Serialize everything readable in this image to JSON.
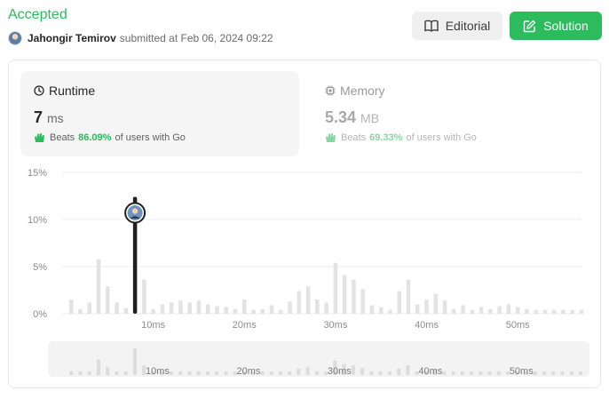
{
  "header": {
    "status": "Accepted",
    "submitter_name": "Jahongir Temirov",
    "submitted_text": "submitted at Feb 06, 2024 09:22",
    "editorial_label": "Editorial",
    "solution_label": "Solution"
  },
  "runtime": {
    "title": "Runtime",
    "value": "7",
    "unit": "ms",
    "beats_label": "Beats",
    "beats_pct": "86.09%",
    "beats_suffix": "of users with Go"
  },
  "memory": {
    "title": "Memory",
    "value": "5.34",
    "unit": "MB",
    "beats_label": "Beats",
    "beats_pct": "69.33%",
    "beats_suffix": "of users with Go"
  },
  "colors": {
    "accent": "#2cbb5d",
    "bar": "#e3e3e3",
    "highlight": "#1f1f1f"
  },
  "chart_data": {
    "type": "bar",
    "title": "",
    "xlabel": "",
    "ylabel": "",
    "y_ticks": [
      "15%",
      "10%",
      "5%",
      "0%"
    ],
    "ylim": [
      0,
      15
    ],
    "xlim": [
      0,
      57
    ],
    "x_ticks": [
      {
        "value": 10,
        "label": "10ms"
      },
      {
        "value": 20,
        "label": "20ms"
      },
      {
        "value": 30,
        "label": "30ms"
      },
      {
        "value": 40,
        "label": "40ms"
      },
      {
        "value": 50,
        "label": "50ms"
      }
    ],
    "x": [
      1,
      2,
      3,
      4,
      5,
      6,
      7,
      8,
      9,
      10,
      11,
      12,
      13,
      14,
      15,
      16,
      17,
      18,
      19,
      20,
      21,
      22,
      23,
      24,
      25,
      26,
      27,
      28,
      29,
      30,
      31,
      32,
      33,
      34,
      35,
      36,
      37,
      38,
      39,
      40,
      41,
      42,
      43,
      44,
      45,
      46,
      47,
      48,
      49,
      50,
      51,
      52,
      53,
      54,
      55,
      56,
      57
    ],
    "values": [
      1.5,
      0.5,
      1.2,
      5.8,
      2.9,
      1.2,
      0.6,
      12.4,
      3.6,
      0.5,
      1.0,
      1.2,
      1.4,
      1.2,
      1.4,
      1.0,
      0.8,
      0.7,
      0.5,
      1.5,
      0.4,
      0.5,
      0.9,
      0.4,
      1.3,
      2.4,
      2.9,
      1.5,
      1.2,
      5.4,
      4.1,
      3.6,
      2.6,
      0.9,
      0.7,
      0.4,
      2.4,
      3.6,
      1.0,
      1.5,
      2.1,
      1.4,
      0.5,
      0.9,
      0.4,
      0.7,
      0.5,
      0.8,
      1.0,
      0.7,
      0.5,
      0.4,
      0.4,
      0.4,
      0.4,
      0.4,
      0.4
    ],
    "highlight_x": 8,
    "highlight_value": 12.4
  }
}
